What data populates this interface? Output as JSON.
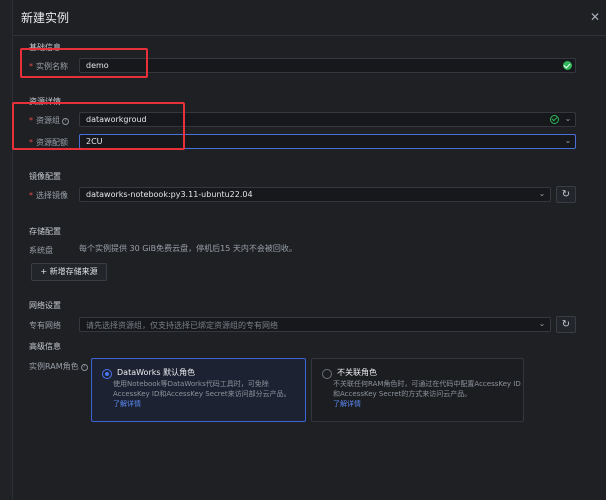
{
  "dialog": {
    "title": "新建实例"
  },
  "basic": {
    "section_title": "基础信息",
    "instance_name_label": "实例名称",
    "instance_name_value": "demo"
  },
  "resource": {
    "section_title": "资源详情",
    "group_label": "资源组",
    "group_value": "dataworkgroud",
    "spec_label": "资源配额",
    "spec_value": "2CU"
  },
  "image": {
    "section_title": "镜像配置",
    "select_label": "选择镜像",
    "select_value": "dataworks-notebook:py3.11-ubuntu22.04"
  },
  "storage": {
    "section_title": "存储配置",
    "system_disk_label": "系统盘",
    "system_disk_hint": "每个实例提供 30 GiB免费云盘，停机后15 天内不会被回收。",
    "add_button": "新增存储来源"
  },
  "network": {
    "section_title": "网络设置",
    "vpc_label": "专有网络",
    "vpc_placeholder": "请先选择资源组，仅支持选择已绑定资源组的专有网络"
  },
  "advanced": {
    "section_title": "高级信息",
    "ram_label": "实例RAM角色",
    "options": [
      {
        "title": "DataWorks 默认角色",
        "desc": "使用Notebook等DataWorks代码工具时，可免除AccessKey ID和AccessKey Secret来访问部分云产品。",
        "link": "了解详情"
      },
      {
        "title": "不关联角色",
        "desc": "不关联任何RAM角色时，可通过在代码中配置AccessKey ID和AccessKey Secret的方式来访问云产品。",
        "link": "了解详情"
      }
    ]
  },
  "colors": {
    "accent": "#4a74f0",
    "annotation": "#e8303a",
    "success": "#2fb55a",
    "required": "#e84a4a"
  },
  "icons": [
    "close-icon",
    "check-circle-icon",
    "chevron-down-icon",
    "refresh-icon",
    "plus-icon",
    "info-icon"
  ]
}
